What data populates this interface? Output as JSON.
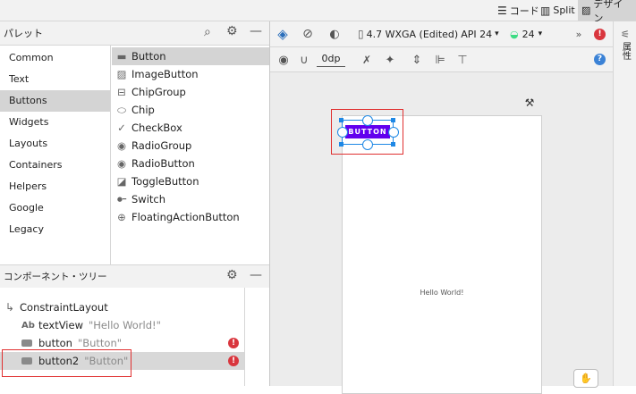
{
  "top": {
    "code_label": "コード",
    "split_label": "Split",
    "design_label": "デザイン"
  },
  "palette": {
    "title": "パレット",
    "categories": [
      "Common",
      "Text",
      "Buttons",
      "Widgets",
      "Layouts",
      "Containers",
      "Helpers",
      "Google",
      "Legacy"
    ],
    "selected_category": "Buttons",
    "widgets": [
      "Button",
      "ImageButton",
      "ChipGroup",
      "Chip",
      "CheckBox",
      "RadioGroup",
      "RadioButton",
      "ToggleButton",
      "Switch",
      "FloatingActionButton"
    ]
  },
  "tree": {
    "title": "コンポーネント・ツリー",
    "root": "ConstraintLayout",
    "items": [
      {
        "icon": "Ab",
        "name": "textView",
        "hint": "\"Hello World!\"",
        "error": false
      },
      {
        "icon": "",
        "name": "button",
        "hint": "\"Button\"",
        "error": true
      },
      {
        "icon": "",
        "name": "button2",
        "hint": "\"Button\"",
        "error": true
      }
    ]
  },
  "toolbar": {
    "device_label": "4.7  WXGA (Edited)",
    "api_label": "API 24",
    "theme_api": "24",
    "margin_value": "0dp"
  },
  "canvas": {
    "button_text": "BUTTON",
    "hello_text": "Hello World!"
  },
  "side": {
    "attributes_label": "属性"
  },
  "colors": {
    "accent": "#6200ee",
    "error": "#d9363e",
    "selection_box": "#e03030",
    "handle": "#1e88e5"
  }
}
